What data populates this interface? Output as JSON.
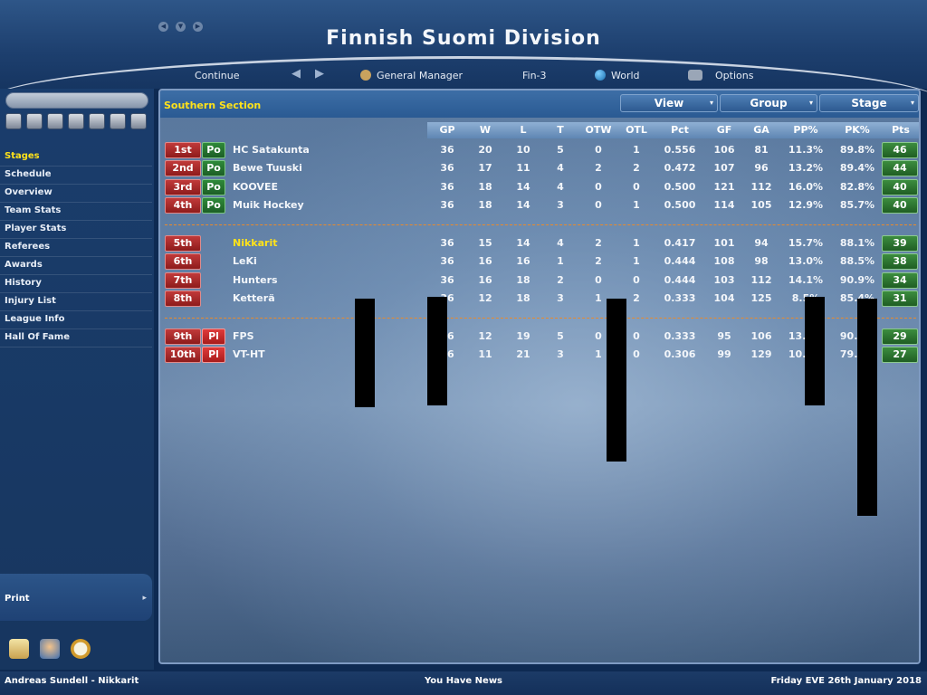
{
  "window": {
    "title": "Finnish Suomi Division",
    "controls": [
      "◀",
      "▼",
      "▶"
    ]
  },
  "topnav": {
    "continue_label": "Continue",
    "back_arrow": "◀",
    "forward_arrow": "▶",
    "gm_label": "General Manager",
    "league_label": "Fin-3",
    "world_label": "World",
    "options_label": "Options"
  },
  "sidebar": {
    "items": [
      {
        "label": "Stages",
        "active": true
      },
      {
        "label": "Schedule"
      },
      {
        "label": "Overview"
      },
      {
        "label": "Team Stats"
      },
      {
        "label": "Player Stats"
      },
      {
        "label": "Referees"
      },
      {
        "label": "Awards"
      },
      {
        "label": "History"
      },
      {
        "label": "Injury List"
      },
      {
        "label": "League Info"
      },
      {
        "label": "Hall Of Fame"
      }
    ],
    "print_label": "Print",
    "print_arrow": "▸"
  },
  "section": {
    "title": "Southern Section",
    "view_label": "View",
    "group_label": "Group",
    "stage_label": "Stage",
    "caret": "▾"
  },
  "table": {
    "columns": [
      "GP",
      "W",
      "L",
      "T",
      "OTW",
      "OTL",
      "Pct",
      "GF",
      "GA",
      "PP%",
      "PK%",
      "Pts"
    ],
    "rows": [
      {
        "rank": "1st",
        "badge": "Po",
        "team": "HC Satakunta",
        "gp": "36",
        "w": "20",
        "l": "10",
        "t": "5",
        "otw": "0",
        "otl": "1",
        "pct": "0.556",
        "gf": "106",
        "ga": "81",
        "pp": "11.3%",
        "pk": "89.8%",
        "pts": "46"
      },
      {
        "rank": "2nd",
        "badge": "Po",
        "team": "Bewe Tuuski",
        "gp": "36",
        "w": "17",
        "l": "11",
        "t": "4",
        "otw": "2",
        "otl": "2",
        "pct": "0.472",
        "gf": "107",
        "ga": "96",
        "pp": "13.2%",
        "pk": "89.4%",
        "pts": "44"
      },
      {
        "rank": "3rd",
        "badge": "Po",
        "team": "KOOVEE",
        "gp": "36",
        "w": "18",
        "l": "14",
        "t": "4",
        "otw": "0",
        "otl": "0",
        "pct": "0.500",
        "gf": "121",
        "ga": "112",
        "pp": "16.0%",
        "pk": "82.8%",
        "pts": "40"
      },
      {
        "rank": "4th",
        "badge": "Po",
        "team": "Muik Hockey",
        "gp": "36",
        "w": "18",
        "l": "14",
        "t": "3",
        "otw": "0",
        "otl": "1",
        "pct": "0.500",
        "gf": "114",
        "ga": "105",
        "pp": "12.9%",
        "pk": "85.7%",
        "pts": "40"
      },
      {
        "rank": "5th",
        "badge": "",
        "team": "Nikkarit",
        "highlight": true,
        "gp": "36",
        "w": "15",
        "l": "14",
        "t": "4",
        "otw": "2",
        "otl": "1",
        "pct": "0.417",
        "gf": "101",
        "ga": "94",
        "pp": "15.7%",
        "pk": "88.1%",
        "pts": "39"
      },
      {
        "rank": "6th",
        "badge": "",
        "team": "LeKi",
        "gp": "36",
        "w": "16",
        "l": "16",
        "t": "1",
        "otw": "2",
        "otl": "1",
        "pct": "0.444",
        "gf": "108",
        "ga": "98",
        "pp": "13.0%",
        "pk": "88.5%",
        "pts": "38"
      },
      {
        "rank": "7th",
        "badge": "",
        "team": "Hunters",
        "gp": "36",
        "w": "16",
        "l": "18",
        "t": "2",
        "otw": "0",
        "otl": "0",
        "pct": "0.444",
        "gf": "103",
        "ga": "112",
        "pp": "14.1%",
        "pk": "90.9%",
        "pts": "34"
      },
      {
        "rank": "8th",
        "badge": "",
        "team": "Ketterä",
        "gp": "36",
        "w": "12",
        "l": "18",
        "t": "3",
        "otw": "1",
        "otl": "2",
        "pct": "0.333",
        "gf": "104",
        "ga": "125",
        "pp": "8.5%",
        "pk": "85.4%",
        "pts": "31"
      },
      {
        "rank": "9th",
        "badge": "Pl",
        "team": "FPS",
        "gp": "36",
        "w": "12",
        "l": "19",
        "t": "5",
        "otw": "0",
        "otl": "0",
        "pct": "0.333",
        "gf": "95",
        "ga": "106",
        "pp": "13.7%",
        "pk": "90.2%",
        "pts": "29"
      },
      {
        "rank": "10th",
        "badge": "Pl",
        "team": "VT-HT",
        "gp": "36",
        "w": "11",
        "l": "21",
        "t": "3",
        "otw": "1",
        "otl": "0",
        "pct": "0.306",
        "gf": "99",
        "ga": "129",
        "pp": "10.6%",
        "pk": "79.7%",
        "pts": "27"
      }
    ]
  },
  "status": {
    "left": "Andreas Sundell - Nikkarit",
    "center": "You Have News",
    "right": "Friday EVE 26th January 2018"
  },
  "colors": {
    "highlight_text": "#ffe21a",
    "rank_red": "#b02a2a",
    "playoff_green": "#2f8a3a",
    "playout_red": "#e03b3b",
    "points_green": "#2f7a33",
    "separator_orange": "#e98a2c"
  }
}
